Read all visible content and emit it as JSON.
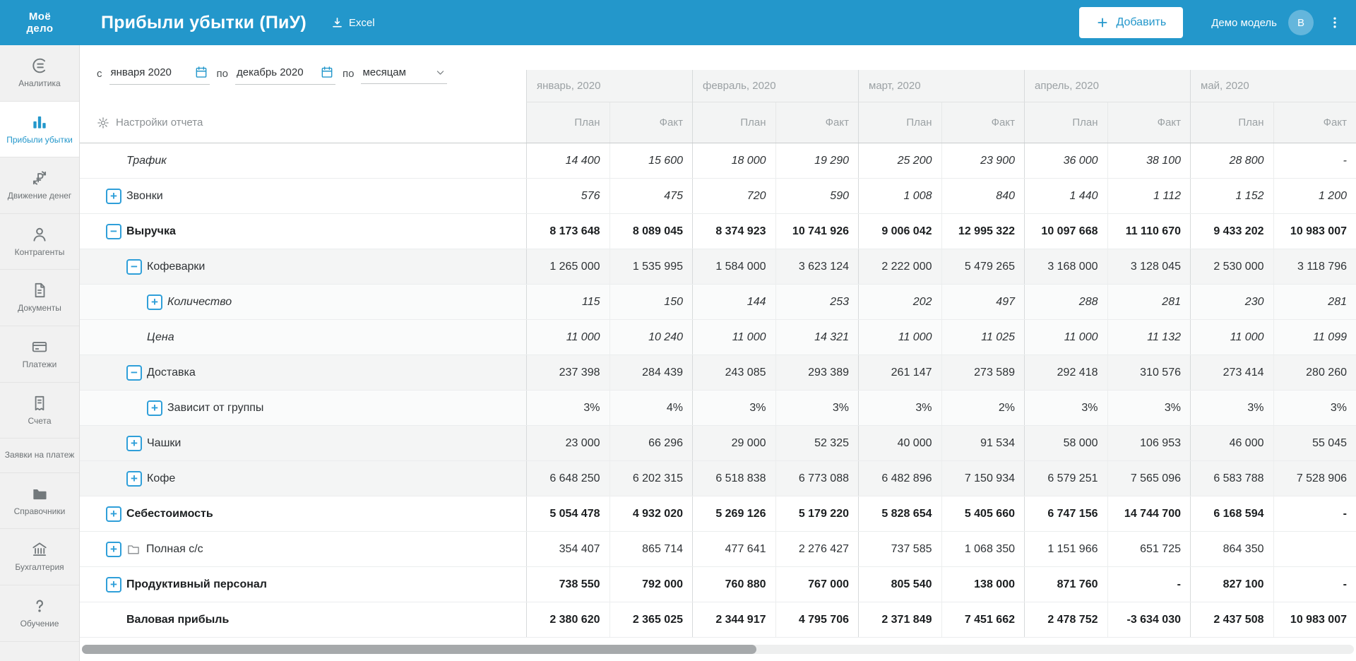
{
  "topbar": {
    "logo_line1": "Моё",
    "logo_line2": "дело",
    "title": "Прибыли убытки (ПиУ)",
    "excel_label": "Excel",
    "add_button_label": "Добавить",
    "user_label": "Демо модель",
    "avatar_initial": "В"
  },
  "sidebar": {
    "items": [
      {
        "id": "analytics",
        "label": "Аналитика",
        "icon": "analytics-gauge-icon",
        "active": false
      },
      {
        "id": "profit-loss",
        "label": "Прибыли убытки",
        "icon": "bar-chart-icon",
        "active": true
      },
      {
        "id": "money-flow",
        "label": "Движение денег",
        "icon": "ruble-flow-icon",
        "active": false
      },
      {
        "id": "contractors",
        "label": "Контрагенты",
        "icon": "person-icon",
        "active": false
      },
      {
        "id": "documents",
        "label": "Документы",
        "icon": "document-icon",
        "active": false
      },
      {
        "id": "payments",
        "label": "Платежи",
        "icon": "payment-card-icon",
        "active": false
      },
      {
        "id": "invoices",
        "label": "Счета",
        "icon": "invoice-icon",
        "active": false
      },
      {
        "id": "payment-requests",
        "label": "Заявки на платеж",
        "icon": null,
        "active": false
      },
      {
        "id": "directories",
        "label": "Справочники",
        "icon": "folder-icon",
        "active": false
      },
      {
        "id": "accounting",
        "label": "Бухгалтерия",
        "icon": "bank-icon",
        "active": false
      },
      {
        "id": "training",
        "label": "Обучение",
        "icon": "question-icon",
        "active": false
      }
    ]
  },
  "filters": {
    "from_label": "с",
    "from_value": "января 2020",
    "to_label": "по",
    "to_value": "декабрь 2020",
    "period_label": "по",
    "period_value": "месяцам",
    "settings_label": "Настройки отчета"
  },
  "table": {
    "months": [
      "январь, 2020",
      "февраль, 2020",
      "март, 2020",
      "апрель, 2020",
      "май, 2020"
    ],
    "subheaders": [
      "План",
      "Факт"
    ],
    "rows": [
      {
        "id": "traffic",
        "label": "Трафик",
        "depth": 0,
        "expand": "",
        "reserve": true,
        "bold": false,
        "italic_label": true,
        "italic_values": true,
        "folder": false,
        "values": [
          "14 400",
          "15 600",
          "18 000",
          "19 290",
          "25 200",
          "23 900",
          "36 000",
          "38 100",
          "28 800",
          "-"
        ]
      },
      {
        "id": "calls",
        "label": "Звонки",
        "depth": 0,
        "expand": "plus",
        "reserve": false,
        "bold": false,
        "italic_label": false,
        "italic_values": true,
        "folder": false,
        "values": [
          "576",
          "475",
          "720",
          "590",
          "1 008",
          "840",
          "1 440",
          "1 112",
          "1 152",
          "1 200"
        ]
      },
      {
        "id": "revenue",
        "label": "Выручка",
        "depth": 0,
        "expand": "minus",
        "reserve": false,
        "bold": true,
        "italic_label": false,
        "italic_values": false,
        "folder": false,
        "values": [
          "8 173 648",
          "8 089 045",
          "8 374 923",
          "10 741 926",
          "9 006 042",
          "12 995 322",
          "10 097 668",
          "11 110 670",
          "9 433 202",
          "10 983 007"
        ]
      },
      {
        "id": "coffee-machines",
        "label": "Кофеварки",
        "depth": 1,
        "expand": "minus",
        "reserve": false,
        "bold": false,
        "italic_label": false,
        "italic_values": false,
        "folder": false,
        "values": [
          "1 265 000",
          "1 535 995",
          "1 584 000",
          "3 623 124",
          "2 222 000",
          "5 479 265",
          "3 168 000",
          "3 128 045",
          "2 530 000",
          "3 118 796"
        ]
      },
      {
        "id": "quantity",
        "label": "Количество",
        "depth": 2,
        "expand": "plus",
        "reserve": false,
        "bold": false,
        "italic_label": true,
        "italic_values": true,
        "folder": false,
        "values": [
          "115",
          "150",
          "144",
          "253",
          "202",
          "497",
          "288",
          "281",
          "230",
          "281"
        ]
      },
      {
        "id": "price",
        "label": "Цена",
        "depth": 2,
        "expand": "",
        "reserve": false,
        "bold": false,
        "italic_label": true,
        "italic_values": true,
        "folder": false,
        "values": [
          "11 000",
          "10 240",
          "11 000",
          "14 321",
          "11 000",
          "11 025",
          "11 000",
          "11 132",
          "11 000",
          "11 099"
        ]
      },
      {
        "id": "delivery",
        "label": "Доставка",
        "depth": 1,
        "expand": "minus",
        "reserve": false,
        "bold": false,
        "italic_label": false,
        "italic_values": false,
        "folder": false,
        "values": [
          "237 398",
          "284 439",
          "243 085",
          "293 389",
          "261 147",
          "273 589",
          "292 418",
          "310 576",
          "273 414",
          "280 260"
        ]
      },
      {
        "id": "group-dependent",
        "label": "Зависит от группы",
        "depth": 2,
        "expand": "plus",
        "reserve": false,
        "bold": false,
        "italic_label": false,
        "italic_values": false,
        "folder": false,
        "values": [
          "3%",
          "4%",
          "3%",
          "3%",
          "3%",
          "2%",
          "3%",
          "3%",
          "3%",
          "3%"
        ]
      },
      {
        "id": "cups",
        "label": "Чашки",
        "depth": 1,
        "expand": "plus",
        "reserve": false,
        "bold": false,
        "italic_label": false,
        "italic_values": false,
        "folder": false,
        "values": [
          "23 000",
          "66 296",
          "29 000",
          "52 325",
          "40 000",
          "91 534",
          "58 000",
          "106 953",
          "46 000",
          "55 045"
        ]
      },
      {
        "id": "coffee",
        "label": "Кофе",
        "depth": 1,
        "expand": "plus",
        "reserve": false,
        "bold": false,
        "italic_label": false,
        "italic_values": false,
        "folder": false,
        "values": [
          "6 648 250",
          "6 202 315",
          "6 518 838",
          "6 773 088",
          "6 482 896",
          "7 150 934",
          "6 579 251",
          "7 565 096",
          "6 583 788",
          "7 528 906"
        ]
      },
      {
        "id": "cost",
        "label": "Себестоимость",
        "depth": 0,
        "expand": "plus",
        "reserve": false,
        "bold": true,
        "italic_label": false,
        "italic_values": false,
        "folder": false,
        "values": [
          "5 054 478",
          "4 932 020",
          "5 269 126",
          "5 179 220",
          "5 828 654",
          "5 405 660",
          "6 747 156",
          "14 744 700",
          "6 168 594",
          "-"
        ]
      },
      {
        "id": "full-cost",
        "label": "Полная с/с",
        "depth": 0,
        "expand": "plus",
        "reserve": false,
        "bold": false,
        "italic_label": false,
        "italic_values": false,
        "folder": true,
        "values": [
          "354 407",
          "865 714",
          "477 641",
          "2 276 427",
          "737 585",
          "1 068 350",
          "1 151 966",
          "651 725",
          "864 350",
          ""
        ]
      },
      {
        "id": "productive-staff",
        "label": "Продуктивный персонал",
        "depth": 0,
        "expand": "plus",
        "reserve": false,
        "bold": true,
        "italic_label": false,
        "italic_values": false,
        "folder": false,
        "values": [
          "738 550",
          "792 000",
          "760 880",
          "767 000",
          "805 540",
          "138 000",
          "871 760",
          "-",
          "827 100",
          "-"
        ]
      },
      {
        "id": "gross-profit",
        "label": "Валовая прибыль",
        "depth": 0,
        "expand": "",
        "reserve": true,
        "bold": true,
        "italic_label": false,
        "italic_values": false,
        "folder": false,
        "values": [
          "2 380 620",
          "2 365 025",
          "2 344 917",
          "4 795 706",
          "2 371 849",
          "7 451 662",
          "2 478 752",
          "-3 634 030",
          "2 437 508",
          "10 983 007"
        ]
      }
    ]
  },
  "colors": {
    "accent": "#2397cb",
    "header_bg": "#2397cb",
    "avatar_bg": "#64b6dc",
    "expand_icon": "#2f9fd9",
    "month_header_bg": "#f3f4f4",
    "child_row_bg": "#f4f5f5"
  }
}
